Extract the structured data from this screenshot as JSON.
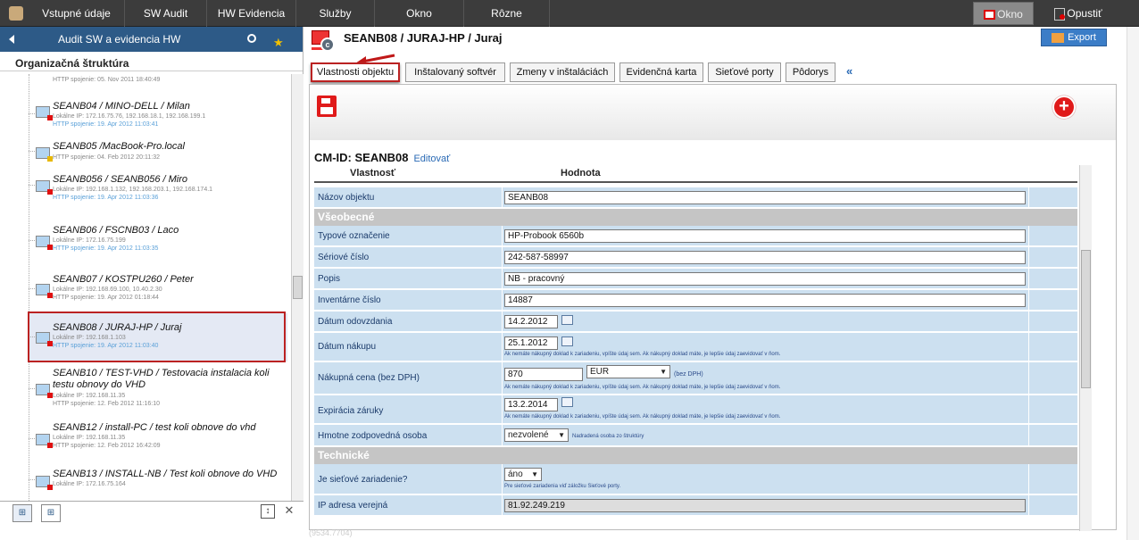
{
  "menu": {
    "items": [
      "Vstupné údaje",
      "SW Audit",
      "HW Evidencia",
      "Služby",
      "Okno",
      "Rôzne"
    ],
    "okno_label": "Okno",
    "opustit_label": "Opustiť"
  },
  "left": {
    "header_title": "Audit SW a evidencia HW",
    "org_label": "Organizačná štruktúra",
    "top_http": "HTTP spojenie: 05. Nov 2011 18:40:49",
    "nodes": [
      {
        "name": "SEANB04 / MINO-DELL / Milan",
        "ip": "Lokálne IP: 172.16.75.76, 192.168.18.1, 192.168.199.1",
        "http": "HTTP spojenie: 19. Apr 2012 11:03:41"
      },
      {
        "name": "SEANB05 /MacBook-Pro.local",
        "ip": "",
        "http": "HTTP spojenie: 04. Feb 2012 20:11:32"
      },
      {
        "name": "SEANB056 / SEANB056 / Miro",
        "ip": "Lokálne IP: 192.168.1.132, 192.168.203.1, 192.168.174.1",
        "http": "HTTP spojenie: 19. Apr 2012 11:03:36"
      },
      {
        "name": "SEANB06 / FSCNB03 / Laco",
        "ip": "Lokálne IP: 172.16.75.199",
        "http": "HTTP spojenie: 19. Apr 2012 11:03:35"
      },
      {
        "name": "SEANB07 / KOSTPU260 / Peter",
        "ip": "Lokálne IP: 192.168.69.100, 10.40.2.30",
        "http": "HTTP spojenie: 19. Apr 2012 01:18:44"
      },
      {
        "name": "SEANB08 / JURAJ-HP / Juraj",
        "ip": "Lokálne IP: 192.168.1.103",
        "http": "HTTP spojenie: 19. Apr 2012 11:03:40"
      },
      {
        "name": "SEANB10 / TEST-VHD / Testovacia instalacia koli testu obnovy do VHD",
        "ip": "Lokálne IP: 192.168.11.35",
        "http": "HTTP spojenie: 12. Feb 2012 11:16:10"
      },
      {
        "name": "SEANB12 / install-PC / test koli obnove do vhd",
        "ip": "Lokálne IP: 192.168.11.35",
        "http": "HTTP spojenie: 12. Feb 2012 16:42:09"
      },
      {
        "name": "SEANB13 / INSTALL-NB / Test koli obnove do VHD",
        "ip": "Lokálne IP: 172.16.75.164",
        "http": ""
      }
    ]
  },
  "right": {
    "title": "SEANB08 / JURAJ-HP / Juraj",
    "export_label": "Export",
    "tabs": [
      "Vlastnosti objektu",
      "Inštalovaný softvér",
      "Zmeny v inštaláciách",
      "Evidenčná karta",
      "Sieťové porty",
      "Pôdorys"
    ],
    "tabs_more": "«",
    "cm_id": "CM-ID: SEANB08",
    "edit_label": "Editovať",
    "col_property": "Vlastnosť",
    "col_value": "Hodnota",
    "rows": {
      "nazov_label": "Názov objektu",
      "nazov_val": "SEANB08",
      "sect_vseobecne": "Všeobecné",
      "typ_label": "Typové označenie",
      "typ_val": "HP-Probook 6560b",
      "seriove_label": "Sériové číslo",
      "seriove_val": "242-587-58997",
      "popis_label": "Popis",
      "popis_val": "NB - pracovný",
      "inv_label": "Inventárne číslo",
      "inv_val": "14887",
      "odovzdania_label": "Dátum odovzdania",
      "odovzdania_val": "14.2.2012",
      "nakupu_label": "Dátum nákupu",
      "nakupu_val": "25.1.2012",
      "note_doklad": "Ak nemáte nákupný doklad k zariadeniu, vpíšte údaj sem. Ak nákupný doklad máte, je lepšie údaj zaevidovať v ňom.",
      "cena_label": "Nákupná cena (bez DPH)",
      "cena_val": "870",
      "mena_val": "EUR",
      "bez_dph": "(bez DPH)",
      "zaruka_label": "Expirácia záruky",
      "zaruka_val": "13.2.2014",
      "osoba_label": "Hmotne zodpovedná osoba",
      "osoba_val": "nezvolené",
      "osoba_note": "Nadradená osoba zo štruktúry",
      "sect_technicke": "Technické",
      "sietove_label": "Je sieťové zariadenie?",
      "sietove_val": "áno",
      "sietove_note": "Pre sieťové zariadenia viď záložku Sieťové porty.",
      "ip_label": "IP adresa verejná",
      "ip_val": "81.92.249.219"
    },
    "status_text": "(9534.7704)"
  }
}
